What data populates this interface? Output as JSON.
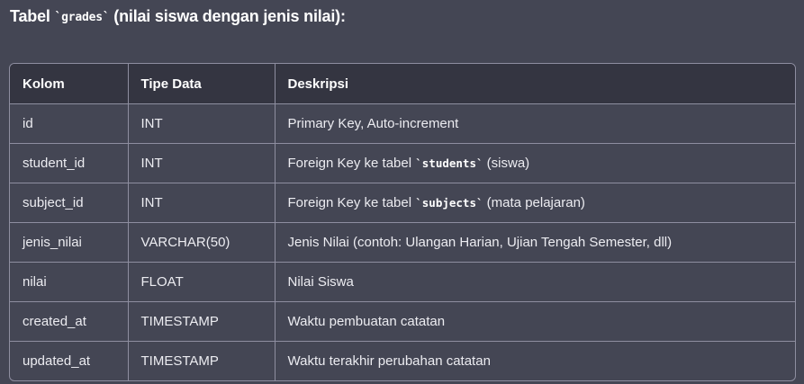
{
  "heading": {
    "prefix": "Tabel ",
    "code": "`grades`",
    "suffix": " (nilai siswa dengan jenis nilai):"
  },
  "table": {
    "headers": [
      "Kolom",
      "Tipe Data",
      "Deskripsi"
    ],
    "rows": [
      {
        "kolom": "id",
        "tipe": "INT",
        "desc_pre": "Primary Key, Auto-increment",
        "desc_code": "",
        "desc_post": ""
      },
      {
        "kolom": "student_id",
        "tipe": "INT",
        "desc_pre": "Foreign Key ke tabel ",
        "desc_code": "`students`",
        "desc_post": " (siswa)"
      },
      {
        "kolom": "subject_id",
        "tipe": "INT",
        "desc_pre": "Foreign Key ke tabel ",
        "desc_code": "`subjects`",
        "desc_post": " (mata pelajaran)"
      },
      {
        "kolom": "jenis_nilai",
        "tipe": "VARCHAR(50)",
        "desc_pre": "Jenis Nilai (contoh: Ulangan Harian, Ujian Tengah Semester, dll)",
        "desc_code": "",
        "desc_post": ""
      },
      {
        "kolom": "nilai",
        "tipe": "FLOAT",
        "desc_pre": "Nilai Siswa",
        "desc_code": "",
        "desc_post": ""
      },
      {
        "kolom": "created_at",
        "tipe": "TIMESTAMP",
        "desc_pre": "Waktu pembuatan catatan",
        "desc_code": "",
        "desc_post": ""
      },
      {
        "kolom": "updated_at",
        "tipe": "TIMESTAMP",
        "desc_pre": "Waktu terakhir perubahan catatan",
        "desc_code": "",
        "desc_post": ""
      }
    ]
  }
}
